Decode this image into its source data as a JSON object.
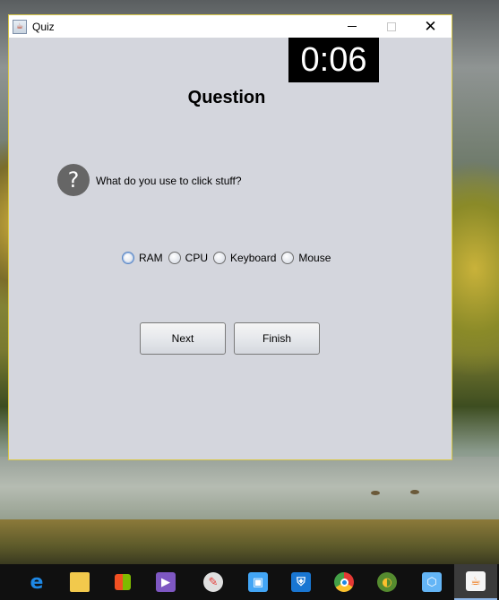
{
  "window": {
    "title": "Quiz",
    "app_icon_name": "java-icon",
    "controls": {
      "minimize": "minimize-icon",
      "maximize": "maximize-icon",
      "close": "✕"
    }
  },
  "timer": {
    "display": "0:06"
  },
  "question": {
    "heading": "Question",
    "icon_glyph": "?",
    "text": "What do you use to click stuff?"
  },
  "options": [
    {
      "label": "RAM",
      "selected": false,
      "focused": true
    },
    {
      "label": "CPU",
      "selected": false,
      "focused": false
    },
    {
      "label": "Keyboard",
      "selected": false,
      "focused": false
    },
    {
      "label": "Mouse",
      "selected": false,
      "focused": false
    }
  ],
  "buttons": {
    "next": "Next",
    "finish": "Finish"
  },
  "taskbar": {
    "items": [
      {
        "name": "edge-icon",
        "color": "#1e88e5"
      },
      {
        "name": "file-explorer-icon",
        "color": "#f2c94c"
      },
      {
        "name": "store-icon",
        "color": "#ffffff"
      },
      {
        "name": "visual-studio-icon",
        "color": "#7e57c2"
      },
      {
        "name": "paint-icon",
        "color": "#e53935"
      },
      {
        "name": "contacts-icon",
        "color": "#42a5f5"
      },
      {
        "name": "defender-icon",
        "color": "#1976d2"
      },
      {
        "name": "chrome-icon",
        "color": "#43a047"
      },
      {
        "name": "eclipse-icon",
        "color": "#fbc02d"
      },
      {
        "name": "virtualbox-icon",
        "color": "#64b5f6"
      },
      {
        "name": "java-icon",
        "color": "#ef6c00",
        "active": true
      }
    ]
  }
}
